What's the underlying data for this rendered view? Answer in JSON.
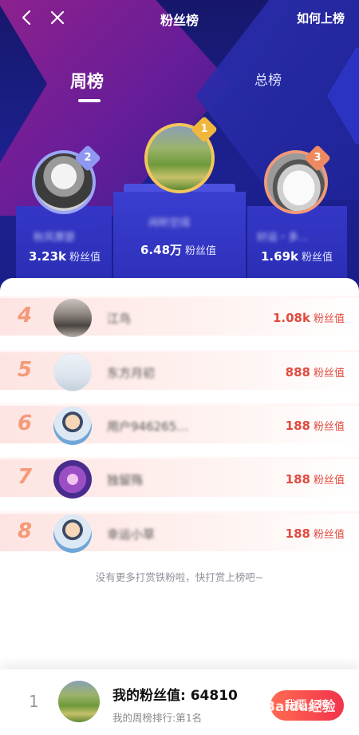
{
  "header": {
    "title": "粉丝榜",
    "how_link": "如何上榜",
    "tabs": {
      "week": "周榜",
      "total": "总榜"
    }
  },
  "top3": [
    {
      "rank": "2",
      "name": "秋风萧瑟",
      "value": "3.23k",
      "unit": "粉丝值"
    },
    {
      "rank": "1",
      "name": "闲听空阔",
      "value": "6.48万",
      "unit": "粉丝值"
    },
    {
      "rank": "3",
      "name": "好运・多…",
      "value": "1.69k",
      "unit": "粉丝值"
    }
  ],
  "list": [
    {
      "rank": "4",
      "name": "江鸟",
      "value": "1.08k",
      "unit": "粉丝值"
    },
    {
      "rank": "5",
      "name": "东方月初",
      "value": "888",
      "unit": "粉丝值"
    },
    {
      "rank": "6",
      "name": "用户946265…",
      "value": "188",
      "unit": "粉丝值"
    },
    {
      "rank": "7",
      "name": "独留殇",
      "value": "188",
      "unit": "粉丝值"
    },
    {
      "rank": "8",
      "name": "幸运小草",
      "value": "188",
      "unit": "粉丝值"
    }
  ],
  "footer_note": "没有更多打赏铁粉啦，快打赏上榜吧~",
  "me": {
    "rank": "1",
    "value_label": "我的粉丝值: 64810",
    "sub_label": "我的周榜排行:第1名",
    "cta_label": "我要上榜",
    "watermark": "Baidu经验"
  },
  "icons": {
    "back": "back-icon",
    "close": "close-icon",
    "crown_badge": "rank-badge"
  },
  "colors": {
    "hero_bg": "#16176a",
    "accent_red": "#e24a3e",
    "rank_orange": "#f59a78",
    "gold": "#f2c65d"
  }
}
